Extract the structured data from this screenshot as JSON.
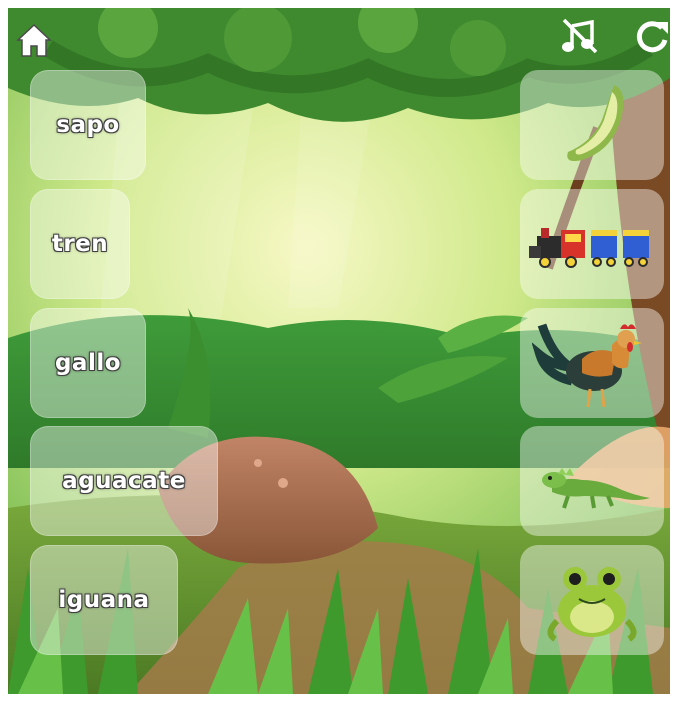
{
  "game": {
    "words": [
      {
        "label": "sapo"
      },
      {
        "label": "tren"
      },
      {
        "label": "gallo"
      },
      {
        "label": "aguacate"
      },
      {
        "label": "iguana"
      }
    ],
    "pictures": [
      {
        "icon": "avocado-icon"
      },
      {
        "icon": "train-icon"
      },
      {
        "icon": "rooster-icon"
      },
      {
        "icon": "iguana-icon"
      },
      {
        "icon": "frog-icon"
      }
    ]
  },
  "hud": {
    "home_icon": "home-icon",
    "music_icon": "music-off-icon",
    "restart_icon": "restart-icon"
  },
  "colors": {
    "sky": "#cfe98a",
    "grass": "#4aa534",
    "hud_icon": "#ffffff"
  }
}
